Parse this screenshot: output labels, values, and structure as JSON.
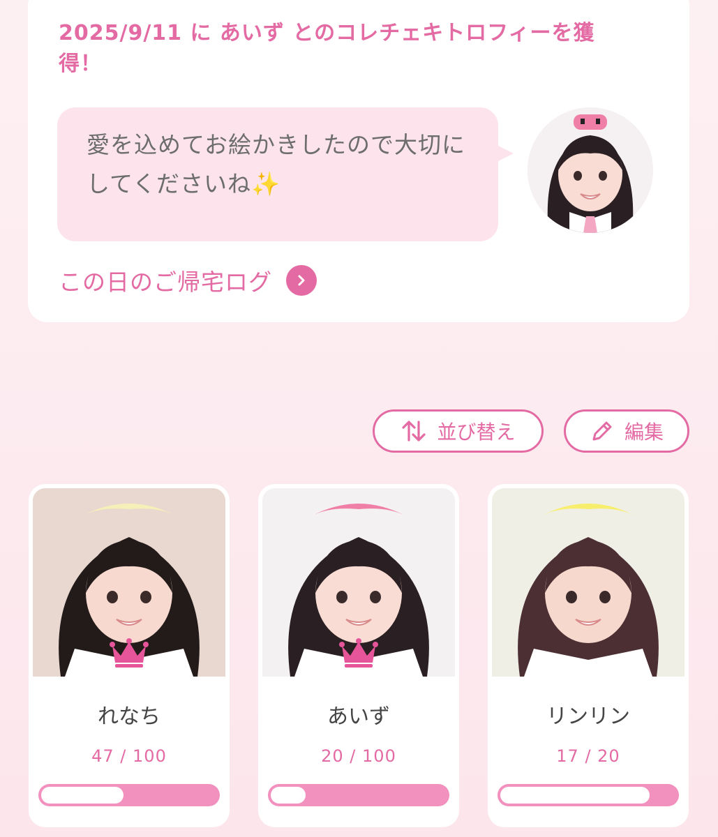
{
  "trophy": {
    "title": "2025/9/11 に あいず とのコレチェキトロフィーを獲得！",
    "message": "愛を込めてお絵かきしたので大切にしてくださいね",
    "message_emoji": "✨",
    "log_link": "この日のご帰宅ログ"
  },
  "toolbar": {
    "sort_label": "並び替え",
    "edit_label": "編集"
  },
  "members": [
    {
      "name": "れなち",
      "count_text": "47 / 100",
      "progress": 0.47,
      "crown": true,
      "bg": "#e9d8cf",
      "hair": "#231a1a",
      "skin": "#f7d9cf",
      "accent": "#f4f0b8"
    },
    {
      "name": "あいず",
      "count_text": "20 / 100",
      "progress": 0.2,
      "crown": true,
      "bg": "#f4f1f2",
      "hair": "#2a1f22",
      "skin": "#f9dcd4",
      "accent": "#f07fa8"
    },
    {
      "name": "リンリン",
      "count_text": "17 / 20",
      "progress": 0.85,
      "crown": false,
      "bg": "#f0efe6",
      "hair": "#4b2f33",
      "skin": "#f7d8cd",
      "accent": "#f6ee6c"
    }
  ],
  "colors": {
    "accent": "#e36aa3",
    "bubble": "#fde4ec",
    "progress_track": "#f291be"
  },
  "icons": [
    "sort-arrows-icon",
    "pencil-icon",
    "chevron-right-icon",
    "crown-icon",
    "sparkles-icon"
  ]
}
